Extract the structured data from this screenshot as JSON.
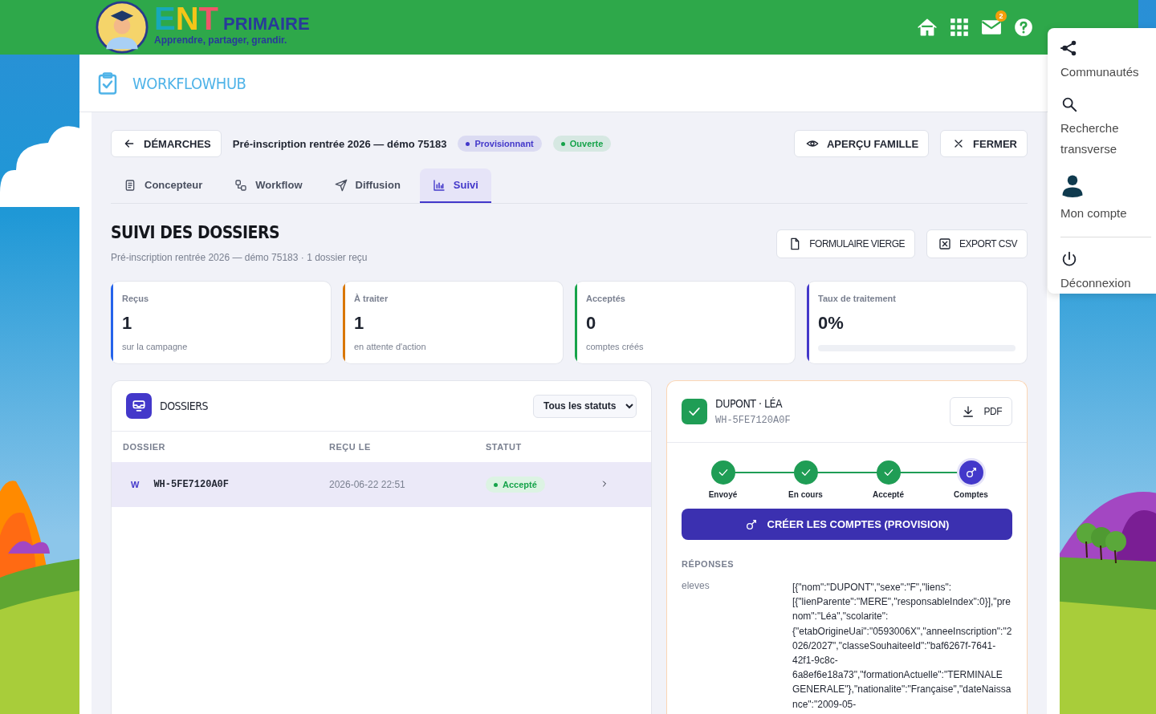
{
  "header": {
    "brand": "ENT",
    "brand_suffix": "PRIMAIRE",
    "tagline": "Apprendre, partager, grandir.",
    "icons": [
      {
        "kind": "home"
      },
      {
        "kind": "apps"
      },
      {
        "kind": "mail",
        "badge": "2"
      },
      {
        "kind": "help"
      }
    ]
  },
  "user_menu": {
    "items": [
      {
        "kind": "communities",
        "label": "Communautés"
      },
      {
        "kind": "search",
        "label": "Recherche transverse"
      },
      {
        "kind": "account",
        "label": "Mon compte"
      },
      {
        "kind": "logout",
        "label": "Déconnexion"
      }
    ]
  },
  "app_bar": {
    "title": "WORKFLOWHUB"
  },
  "toolbar": {
    "back": "DÉMARCHES",
    "title": "Pré-inscription rentrée 2026 — démo 75183",
    "badges": [
      {
        "label": "Provisionnant",
        "color": "#4338ca"
      },
      {
        "label": "Ouverte",
        "color": "#16a34a"
      }
    ],
    "actions": [
      {
        "kind": "eye",
        "label": "APERÇU FAMILLE"
      },
      {
        "kind": "close",
        "label": "FERMER"
      }
    ]
  },
  "tabs": [
    {
      "kind": "doc",
      "label": "Concepteur",
      "selected": false
    },
    {
      "kind": "flow",
      "label": "Workflow",
      "selected": false
    },
    {
      "kind": "send",
      "label": "Diffusion",
      "selected": false
    },
    {
      "kind": "chart",
      "label": "Suivi",
      "selected": true
    }
  ],
  "section": {
    "title": "SUIVI DES DOSSIERS",
    "subtitle": "Pré-inscription rentrée 2026 — démo 75183 · 1 dossier reçu",
    "actions": [
      {
        "kind": "file",
        "label": "FORMULAIRE VIERGE"
      },
      {
        "kind": "csv",
        "label": "EXPORT CSV"
      }
    ]
  },
  "stats": [
    {
      "label": "Reçus",
      "value": "1",
      "note": "sur la campagne",
      "color": "#2563eb"
    },
    {
      "label": "À traiter",
      "value": "1",
      "note": "en attente d'action",
      "color": "#d97706"
    },
    {
      "label": "Acceptés",
      "value": "0",
      "note": "comptes créés",
      "color": "#16a34a"
    },
    {
      "label": "Taux de traitement",
      "value": "0%",
      "level": 0,
      "color": "#4338ca"
    }
  ],
  "dossiers": {
    "title": "DOSSIERS",
    "filter": "Tous les statuts",
    "columns": [
      "DOSSIER",
      "REÇU LE",
      "STATUT"
    ],
    "rows": [
      {
        "initial": "W",
        "id": "WH-5FE7120A0F",
        "received": "2026-06-22 22:51",
        "status": "Accepté",
        "selected": true
      }
    ]
  },
  "detail": {
    "name": "DUPONT · LÉA",
    "id": "WH-5FE7120A0F",
    "pdf": "PDF",
    "steps": [
      {
        "label": "Envoyé",
        "kind": "done"
      },
      {
        "label": "En cours",
        "kind": "done"
      },
      {
        "label": "Accepté",
        "kind": "done"
      },
      {
        "label": "Comptes",
        "kind": "current"
      }
    ],
    "action": "CRÉER LES COMPTES (PROVISION)",
    "responses_title": "RÉPONSES",
    "responses": [
      {
        "label": "eleves",
        "value": "[{\"nom\":\"DUPONT\",\"sexe\":\"F\",\"liens\":[{\"lienParente\":\"MERE\",\"responsableIndex\":0}],\"prenom\":\"Léa\",\"scolarite\":{\"etabOrigineUai\":\"0593006X\",\"anneeInscription\":\"2026/2027\",\"classeSouhaiteeId\":\"baf6267f-7641-42f1-9c8c-6a8ef6e18a73\",\"formationActuelle\":\"TERMINALE GENERALE\"},\"nationalite\":\"Française\",\"dateNaissance\":\"2009-05-"
      }
    ]
  }
}
